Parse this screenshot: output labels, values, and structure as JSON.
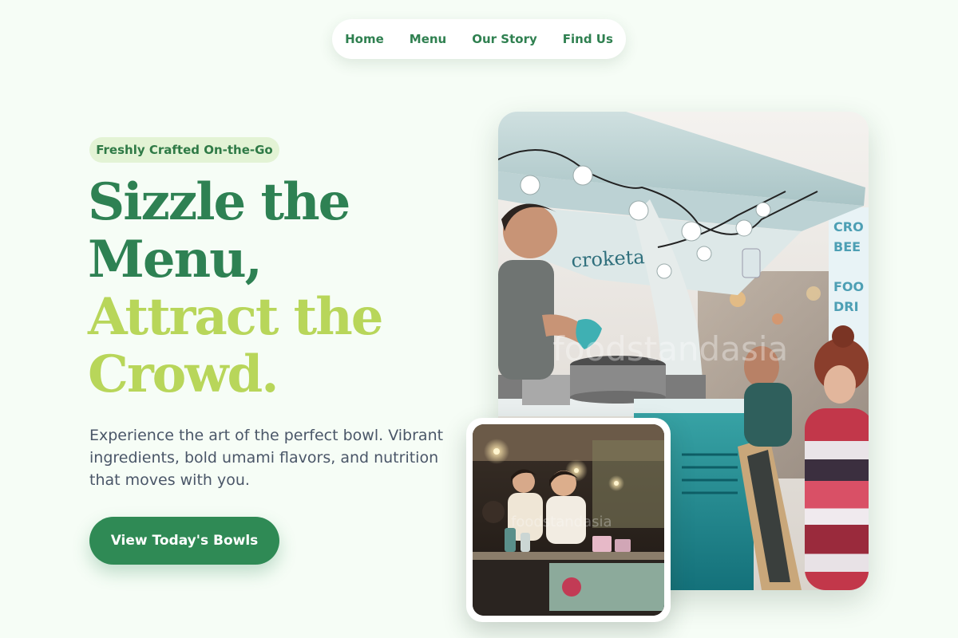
{
  "nav": {
    "items": [
      {
        "label": "Home"
      },
      {
        "label": "Menu"
      },
      {
        "label": "Our Story"
      },
      {
        "label": "Find Us"
      }
    ]
  },
  "hero": {
    "badge": "Freshly Crafted On-the-Go",
    "headline_line1": "Sizzle the",
    "headline_line2": "Menu,",
    "headline_line3": "Attract the",
    "headline_line4": "Crowd.",
    "description": "Experience the art of the perfect bowl. Vibrant ingredients, bold umami flavors, and nutrition that moves with you.",
    "cta_label": "View Today's Bowls"
  },
  "images": {
    "main": {
      "truck_sign": "croketas",
      "side_sign": "CROQ BEER FOOD DRINK",
      "watermark": "foodstandasia"
    },
    "small": {
      "watermark": "foodstandasia"
    }
  },
  "colors": {
    "background": "#f6fdf6",
    "brand_green": "#2f8a55",
    "lime_accent": "#b8d65a",
    "badge_bg": "#e3f3d5",
    "body_text": "#4a5668"
  }
}
